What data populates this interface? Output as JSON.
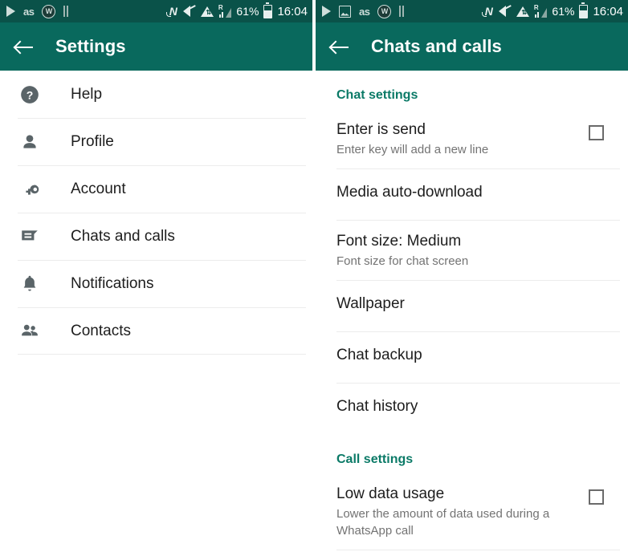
{
  "statusbar": {
    "left_icons_left_panel": [
      "play-icon",
      "lastfm-icon",
      "w-badge-icon",
      "pause-icon"
    ],
    "left_icons_right_panel": [
      "play-icon",
      "image-icon",
      "lastfm-icon",
      "w-badge-icon",
      "pause-icon"
    ],
    "lastfm_label": "as",
    "w_label": "W",
    "nfc_label": "N",
    "roaming_label": "R",
    "battery_percent": "61%",
    "time": "16:04",
    "background_color": "#0a5249"
  },
  "left_panel": {
    "toolbar": {
      "back_icon": "back-arrow-icon",
      "title": "Settings",
      "background_color": "#09695d"
    },
    "items": [
      {
        "label": "Help",
        "icon": "help-icon"
      },
      {
        "label": "Profile",
        "icon": "person-icon"
      },
      {
        "label": "Account",
        "icon": "key-icon"
      },
      {
        "label": "Chats and calls",
        "icon": "chat-bubble-icon"
      },
      {
        "label": "Notifications",
        "icon": "bell-icon"
      },
      {
        "label": "Contacts",
        "icon": "contacts-icon"
      }
    ]
  },
  "right_panel": {
    "toolbar": {
      "back_icon": "back-arrow-icon",
      "title": "Chats and calls",
      "background_color": "#09695d"
    },
    "section_header_color": "#0b7a67",
    "chat_settings": {
      "header": "Chat settings",
      "items": [
        {
          "title": "Enter is send",
          "subtitle": "Enter key will add a new line",
          "checkbox": true,
          "checked": false
        },
        {
          "title": "Media auto-download",
          "subtitle": "",
          "checkbox": false
        },
        {
          "title": "Font size: Medium",
          "subtitle": "Font size for chat screen",
          "checkbox": false
        },
        {
          "title": "Wallpaper",
          "subtitle": "",
          "checkbox": false
        },
        {
          "title": "Chat backup",
          "subtitle": "",
          "checkbox": false
        },
        {
          "title": "Chat history",
          "subtitle": "",
          "checkbox": false
        }
      ]
    },
    "call_settings": {
      "header": "Call settings",
      "items": [
        {
          "title": "Low data usage",
          "subtitle": "Lower the amount of data used during a WhatsApp call",
          "checkbox": true,
          "checked": false
        }
      ]
    }
  }
}
